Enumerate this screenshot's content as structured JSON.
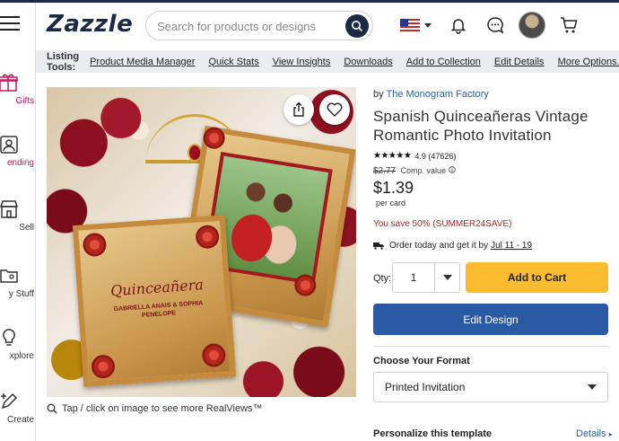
{
  "header": {
    "logo": "Zazzle",
    "search_placeholder": "Search for products or designs"
  },
  "tools_bar": {
    "label": "Listing Tools:",
    "links": [
      "Product Media Manager",
      "Quick Stats",
      "View Insights",
      "Downloads",
      "Add to Collection",
      "Edit Details",
      "More Options..."
    ]
  },
  "left_nav": {
    "items": [
      {
        "label": "Gifts",
        "icon": "gift-icon"
      },
      {
        "label": "ending",
        "icon": "trending-person-icon"
      },
      {
        "label": "Sell",
        "icon": "store-icon"
      },
      {
        "label": "y Stuff",
        "icon": "folder-icon"
      },
      {
        "label": "xplore",
        "icon": "lightbulb-icon"
      },
      {
        "label": "Create",
        "icon": "create-pen-icon"
      }
    ]
  },
  "product_image": {
    "card_script": "Quinceañera",
    "card_names": "GABRIELLA ANAIS & SOPHIA PENELOPE",
    "realviews_hint": "Tap / click on image to see more RealViews™"
  },
  "product": {
    "by_label": "by",
    "brand": "The Monogram Factory",
    "title": "Spanish Quinceañeras Vintage Romantic Photo Invitation",
    "stars": "★★★★★",
    "rating": "4.9",
    "reviews": "(47626)",
    "comp_price": "$2.77",
    "comp_label": "Comp. value",
    "price": "$1.39",
    "per_unit": "per card",
    "savings": "You save 50% (SUMMER24SAVE)",
    "shipping_text": "Order today and get it by",
    "shipping_date": "Jul 11 - 19",
    "qty_label": "Qty:",
    "qty_value": "1",
    "add_to_cart": "Add to Cart",
    "edit_design": "Edit Design",
    "format_label": "Choose Your Format",
    "format_value": "Printed Invitation",
    "personalize_label": "Personalize this template",
    "details_link": "Details"
  },
  "colors": {
    "brand_navy": "#1c2a45",
    "cart_yellow": "#fbbd2e",
    "edit_blue": "#2a5aa3",
    "save_red": "#b02a2a",
    "link_blue": "#2b5ea8"
  }
}
